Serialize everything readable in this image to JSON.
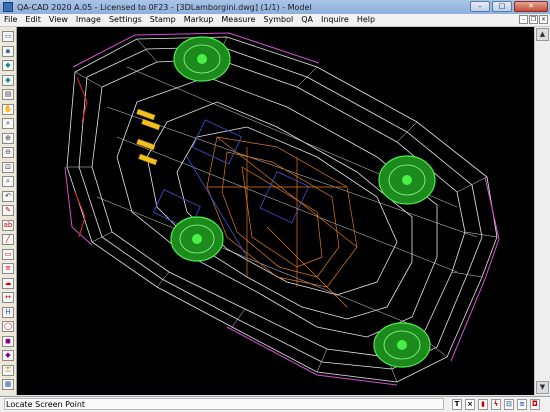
{
  "window": {
    "title": "QA-CAD 2020 A.05 - Licensed to 0F23  - [3DLamborgini.dwg] (1/1) - Model",
    "minimize": "–",
    "maximize": "□",
    "close": "✕"
  },
  "menu": [
    "File",
    "Edit",
    "View",
    "Image",
    "Settings",
    "Stamp",
    "Markup",
    "Measure",
    "Symbol",
    "QA",
    "Inquire",
    "Help"
  ],
  "mdi": {
    "min": "–",
    "restore": "❐",
    "close": "×"
  },
  "toolbar": [
    {
      "name": "open-icon",
      "glyph": "▭",
      "color": "#2b5fa8"
    },
    {
      "name": "save-icon",
      "glyph": "▪",
      "color": "#2b5fa8"
    },
    {
      "name": "stamp-icon",
      "glyph": "◆",
      "color": "#1a8a8a"
    },
    {
      "name": "export-icon",
      "glyph": "◆",
      "color": "#1a8a8a"
    },
    {
      "name": "print-icon",
      "glyph": "▤",
      "color": "#444"
    },
    {
      "name": "pan-icon",
      "glyph": "✋",
      "color": "#a0522d"
    },
    {
      "name": "zoom-icon",
      "glyph": "⌕",
      "color": "#333"
    },
    {
      "name": "zoom-in-icon",
      "glyph": "⊕",
      "color": "#333"
    },
    {
      "name": "zoom-out-icon",
      "glyph": "⊖",
      "color": "#333"
    },
    {
      "name": "zoom-window-icon",
      "glyph": "⊡",
      "color": "#333"
    },
    {
      "name": "zoom-extents-icon",
      "glyph": "⌕",
      "color": "#333"
    },
    {
      "name": "undo-icon",
      "glyph": "↶",
      "color": "#333"
    },
    {
      "name": "pencil-icon",
      "glyph": "✎",
      "color": "#c00"
    },
    {
      "name": "text-icon",
      "glyph": "ab",
      "color": "#c00"
    },
    {
      "name": "line-icon",
      "glyph": "╱",
      "color": "#c00"
    },
    {
      "name": "rectangle-icon",
      "glyph": "▭",
      "color": "#c00"
    },
    {
      "name": "note-icon",
      "glyph": "≡",
      "color": "#c00"
    },
    {
      "name": "cloud-icon",
      "glyph": "☁",
      "color": "#c00"
    },
    {
      "name": "dimension-icon",
      "glyph": "↔",
      "color": "#c00"
    },
    {
      "name": "measure-icon",
      "glyph": "H",
      "color": "#2b5fa8"
    },
    {
      "name": "balloon-icon",
      "glyph": "◯",
      "color": "#c00"
    },
    {
      "name": "highlight-icon",
      "glyph": "◼",
      "color": "#808"
    },
    {
      "name": "symbol-icon",
      "glyph": "◆",
      "color": "#808"
    },
    {
      "name": "key-icon",
      "glyph": "⚿",
      "color": "#b8860b"
    },
    {
      "name": "report-icon",
      "glyph": "▦",
      "color": "#2b5fa8"
    }
  ],
  "statusbar": {
    "text": "Locate Screen Point",
    "icons": [
      {
        "name": "text-mode-icon",
        "glyph": "T",
        "color": "#000"
      },
      {
        "name": "delete-icon",
        "glyph": "×",
        "color": "#000"
      },
      {
        "name": "flag-icon",
        "glyph": "▮",
        "color": "#c00"
      },
      {
        "name": "lightning-icon",
        "glyph": "ϟ",
        "color": "#c00"
      },
      {
        "name": "filter-icon",
        "glyph": "⊟",
        "color": "#2b5fa8"
      },
      {
        "name": "layers-icon",
        "glyph": "≋",
        "color": "#2b5fa8"
      },
      {
        "name": "camera-icon",
        "glyph": "◘",
        "color": "#c00"
      }
    ]
  },
  "scrollbar": {
    "up": "▲",
    "down": "▼"
  }
}
